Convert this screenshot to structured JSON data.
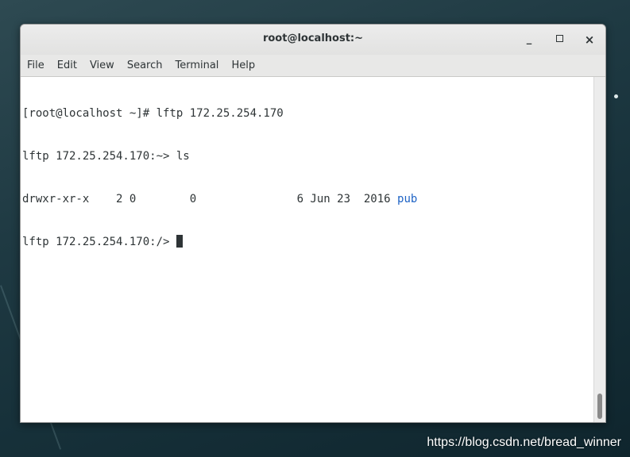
{
  "window": {
    "title": "root@localhost:~",
    "controls": {
      "minimize": "_",
      "close": "×"
    }
  },
  "menu": [
    "File",
    "Edit",
    "View",
    "Search",
    "Terminal",
    "Help"
  ],
  "terminal": {
    "line1": "[root@localhost ~]# lftp 172.25.254.170",
    "line2": "lftp 172.25.254.170:~> ls",
    "line3_prefix": "drwxr-xr-x    2 0        0               6 Jun 23  2016 ",
    "line3_name": "pub",
    "line4": "lftp 172.25.254.170:/> "
  },
  "colors": {
    "directory_link": "#1e63c5",
    "terminal_bg": "#ffffff",
    "text": "#2e3436"
  },
  "watermark": "https://blog.csdn.net/bread_winner"
}
